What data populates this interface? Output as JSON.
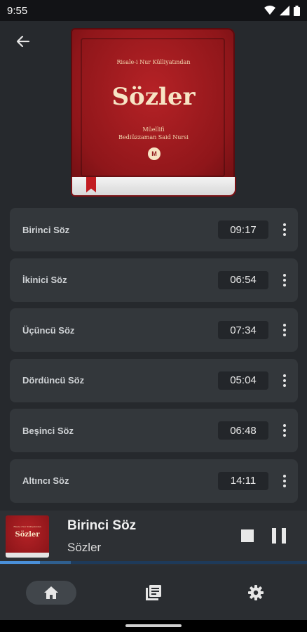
{
  "status_bar": {
    "time": "9:55",
    "icons": [
      "wifi-icon",
      "signal-icon",
      "battery-icon"
    ]
  },
  "header": {
    "back_icon": "arrow-left-icon"
  },
  "cover": {
    "series": "Risale-i Nur Külliyatından",
    "title": "Sözler",
    "author_line1": "Müellifi",
    "author_line2": "Bediüzzaman Said Nursi",
    "logo": "M",
    "color": "#a01b1f"
  },
  "tracks": [
    {
      "title": "Birinci Söz",
      "duration": "09:17"
    },
    {
      "title": "İkinici Söz",
      "duration": "06:54"
    },
    {
      "title": "Üçüncü Söz",
      "duration": "07:34"
    },
    {
      "title": "Dördüncü Söz",
      "duration": "05:04"
    },
    {
      "title": "Beşinci Söz",
      "duration": "06:48"
    },
    {
      "title": "Altıncı Söz",
      "duration": "14:11"
    }
  ],
  "player": {
    "track_title": "Birinci Söz",
    "album": "Sözler",
    "thumb_series": "Risale-i Nur Külliyatından",
    "thumb_title": "Sözler",
    "progress_fraction": 0.13,
    "buffer_fraction": 0.23,
    "progress_color": "#4a90d9"
  },
  "bottom_nav": {
    "items": [
      {
        "icon": "home-icon",
        "active": true
      },
      {
        "icon": "library-icon",
        "active": false
      },
      {
        "icon": "settings-icon",
        "active": false
      }
    ]
  }
}
